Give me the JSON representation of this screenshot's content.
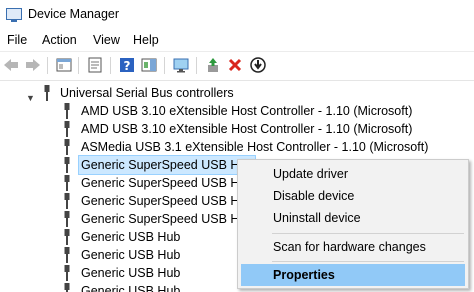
{
  "window": {
    "title": "Device Manager"
  },
  "menu": [
    "File",
    "Action",
    "View",
    "Help"
  ],
  "toolbar": [
    "back-icon",
    "forward-icon",
    "show-hide-tree-icon",
    "properties-icon",
    "help-icon",
    "action-pane-icon",
    "monitor-icon",
    "update-driver-icon",
    "uninstall-icon",
    "disable-icon"
  ],
  "tree": {
    "category": "Universal Serial Bus controllers",
    "devices": [
      "AMD USB 3.10 eXtensible Host Controller - 1.10 (Microsoft)",
      "AMD USB 3.10 eXtensible Host Controller - 1.10 (Microsoft)",
      "ASMedia USB 3.1 eXtensible Host Controller - 1.10 (Microsoft)",
      "Generic SuperSpeed USB Hub",
      "Generic SuperSpeed USB Hub",
      "Generic SuperSpeed USB Hub",
      "Generic SuperSpeed USB Hub",
      "Generic USB Hub",
      "Generic USB Hub",
      "Generic USB Hub",
      "Generic USB Hub"
    ],
    "selected_index": 3
  },
  "context_menu": {
    "items": [
      "Update driver",
      "Disable device",
      "Uninstall device",
      "Scan for hardware changes",
      "Properties"
    ],
    "highlighted": "Properties"
  },
  "colors": {
    "selection": "#cce8ff",
    "menu_highlight": "#91c9f7",
    "uninstall": "#d9261c"
  }
}
